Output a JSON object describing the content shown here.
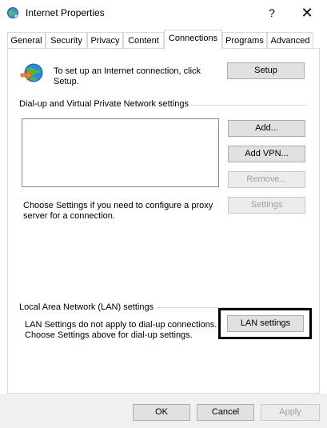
{
  "window": {
    "title": "Internet Properties",
    "help_glyph": "?",
    "close_glyph": "✕"
  },
  "tabs": [
    {
      "label": "General"
    },
    {
      "label": "Security"
    },
    {
      "label": "Privacy"
    },
    {
      "label": "Content"
    },
    {
      "label": "Connections",
      "active": true
    },
    {
      "label": "Programs"
    },
    {
      "label": "Advanced"
    }
  ],
  "setup": {
    "text_line1": "To set up an Internet connection, click",
    "text_line2": "Setup.",
    "button_label": "Setup"
  },
  "dialup": {
    "group_label": "Dial-up and Virtual Private Network settings",
    "add_label": "Add...",
    "add_vpn_label": "Add VPN...",
    "remove_label": "Remove...",
    "settings_label": "Settings",
    "proxy_text_line1": "Choose Settings if you need to configure a proxy",
    "proxy_text_line2": "server for a connection."
  },
  "lan": {
    "group_label": "Local Area Network (LAN) settings",
    "text_line1": "LAN Settings do not apply to dial-up connections.",
    "text_line2": "Choose Settings above for dial-up settings.",
    "button_label": "LAN settings"
  },
  "footer": {
    "ok_label": "OK",
    "cancel_label": "Cancel",
    "apply_label": "Apply"
  }
}
